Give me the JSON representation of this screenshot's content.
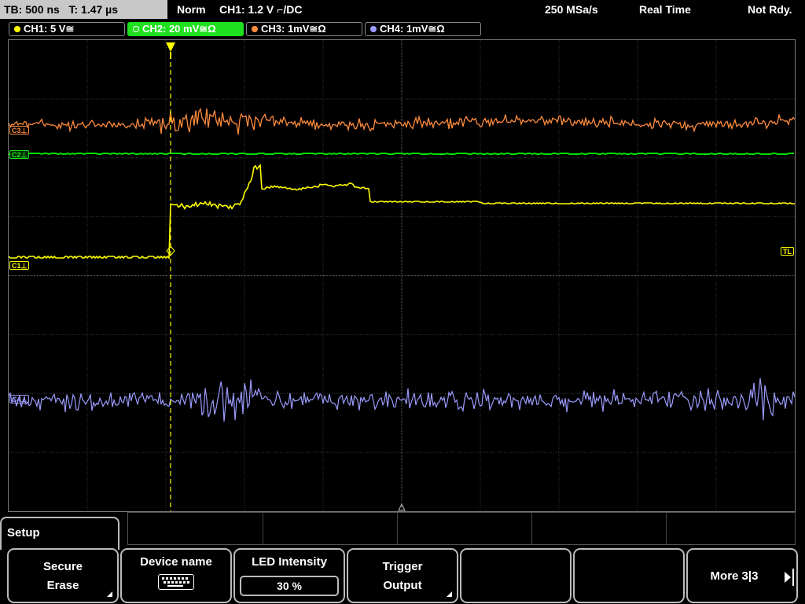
{
  "status_bar": {
    "timebase": "TB: 500 ns",
    "trigger_time": "T: 1.47 µs",
    "mode": "Norm",
    "trigger_info": "CH1: 1.2 V ⌐/DC",
    "sample_rate": "250 MSa/s",
    "acq_mode": "Real Time",
    "state": "Not Rdy."
  },
  "channels": [
    {
      "label": "CH1: 5 V≅",
      "color": "#ffff00",
      "active": false
    },
    {
      "label": "CH2: 20 mV≅Ω",
      "color": "#00e000",
      "active": true
    },
    {
      "label": "CH3: 1mV≅Ω",
      "color": "#ff8c3c",
      "active": false
    },
    {
      "label": "CH4: 1mV≅Ω",
      "color": "#9c9cff",
      "active": false
    }
  ],
  "markers": {
    "c3": "C3⊥",
    "c2": "C2⊥",
    "c1": "C1⊥",
    "c4": "C4⊥",
    "tl": "TL"
  },
  "menu": {
    "title": "Setup",
    "softkeys": {
      "secure_erase_line1": "Secure",
      "secure_erase_line2": "Erase",
      "device_name": "Device name",
      "led_label": "LED Intensity",
      "led_value": "30 %",
      "trigger_output_line1": "Trigger",
      "trigger_output_line2": "Output",
      "more": "More 3|3"
    }
  },
  "colors": {
    "ch1": "#ffff00",
    "ch2": "#00e000",
    "ch3": "#ff8c3c",
    "ch4": "#9c9cff",
    "grid": "#3a3a3a",
    "trigger_marker": "#ffff00"
  }
}
